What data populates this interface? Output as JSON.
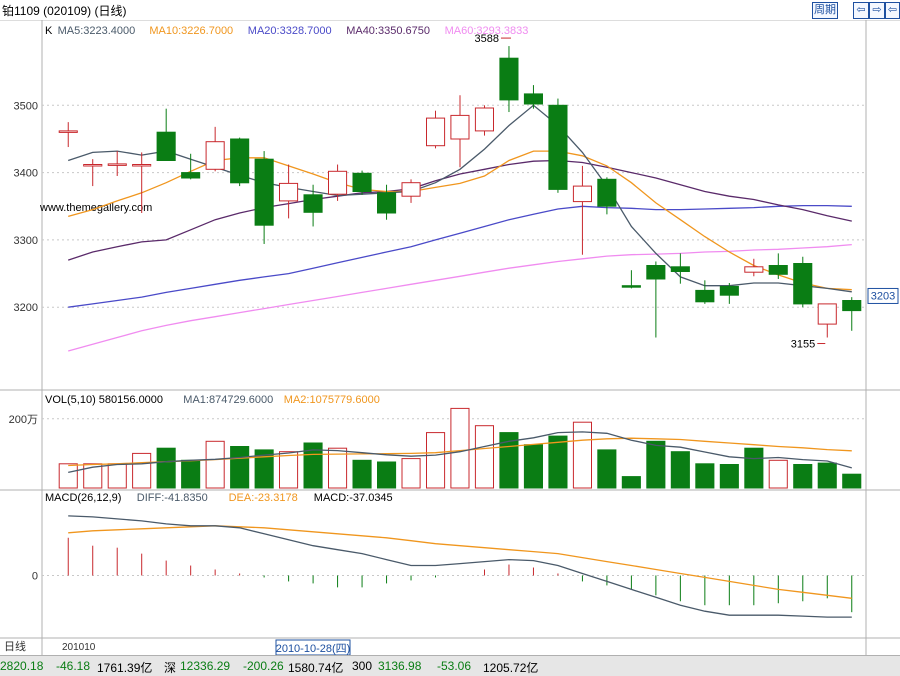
{
  "header": {
    "title": "铂1109 (020109) (日线)",
    "week_label": "周期",
    "nav_left_label": "⇦",
    "nav_right_label": "⇨",
    "nav_full_label": "⇦"
  },
  "watermark": "www.themegallery.com",
  "colors": {
    "up": "#c8282d",
    "down": "#0a7d14",
    "ma5": "#4a5a6a",
    "ma10": "#f0961e",
    "ma20": "#4a4ac8",
    "ma40": "#5a2a6a",
    "ma60": "#f08cf0",
    "vol_ma1": "#4a5a6a",
    "vol_ma2": "#f0961e",
    "diff": "#4a5a6a",
    "dea": "#f0961e"
  },
  "bottom_ticker": {
    "items": [
      {
        "text": "2820.18",
        "color": "#0a7d14"
      },
      {
        "text": "-46.18",
        "color": "#0a7d14"
      },
      {
        "text": "1761.39亿",
        "color": "#000000"
      },
      {
        "text": "深",
        "color": "#000000"
      },
      {
        "text": "12336.29",
        "color": "#0a7d14"
      },
      {
        "text": "-200.26",
        "color": "#0a7d14"
      },
      {
        "text": "1580.74亿",
        "color": "#000000"
      },
      {
        "text": "300",
        "color": "#000000"
      },
      {
        "text": "3136.98",
        "color": "#0a7d14"
      },
      {
        "text": "-53.06",
        "color": "#0a7d14"
      },
      {
        "text": "1205.72亿",
        "color": "#000000"
      }
    ]
  },
  "chart_data": [
    {
      "type": "candlestick",
      "title": "K",
      "legend": [
        {
          "label": "K",
          "color": "#000000"
        },
        {
          "label": "MA5:3223.4000",
          "color": "#4a5a6a"
        },
        {
          "label": "MA10:3226.7000",
          "color": "#f0961e"
        },
        {
          "label": "MA20:3328.7000",
          "color": "#4a4ac8"
        },
        {
          "label": "MA40:3350.6750",
          "color": "#5a2a6a"
        },
        {
          "label": "MA60:3293.3833",
          "color": "#f08cf0"
        }
      ],
      "ylim": [
        3080,
        3600
      ],
      "yticks": [
        3200,
        3300,
        3400,
        3500
      ],
      "last_price_label": "3203",
      "annotations": [
        {
          "label": "3588",
          "index": 18
        },
        {
          "label": "3155",
          "index": 31
        }
      ],
      "candles": [
        {
          "o": 3460,
          "c": 3462,
          "h": 3475,
          "l": 3438
        },
        {
          "o": 3410,
          "c": 3412,
          "h": 3420,
          "l": 3380
        },
        {
          "o": 3412,
          "c": 3413,
          "h": 3432,
          "l": 3395
        },
        {
          "o": 3410,
          "c": 3412,
          "h": 3430,
          "l": 3340
        },
        {
          "o": 3460,
          "c": 3418,
          "h": 3495,
          "l": 3418
        },
        {
          "o": 3400,
          "c": 3392,
          "h": 3428,
          "l": 3390
        },
        {
          "o": 3405,
          "c": 3446,
          "h": 3468,
          "l": 3402
        },
        {
          "o": 3450,
          "c": 3385,
          "h": 3452,
          "l": 3380
        },
        {
          "o": 3420,
          "c": 3322,
          "h": 3432,
          "l": 3294
        },
        {
          "o": 3358,
          "c": 3384,
          "h": 3412,
          "l": 3332
        },
        {
          "o": 3367,
          "c": 3341,
          "h": 3382,
          "l": 3320
        },
        {
          "o": 3368,
          "c": 3402,
          "h": 3412,
          "l": 3358
        },
        {
          "o": 3399,
          "c": 3372,
          "h": 3403,
          "l": 3367
        },
        {
          "o": 3370,
          "c": 3340,
          "h": 3382,
          "l": 3330
        },
        {
          "o": 3365,
          "c": 3385,
          "h": 3390,
          "l": 3355
        },
        {
          "o": 3440,
          "c": 3481,
          "h": 3492,
          "l": 3436
        },
        {
          "o": 3450,
          "c": 3485,
          "h": 3515,
          "l": 3408
        },
        {
          "o": 3462,
          "c": 3496,
          "h": 3500,
          "l": 3455
        },
        {
          "o": 3570,
          "c": 3508,
          "h": 3588,
          "l": 3490
        },
        {
          "o": 3517,
          "c": 3502,
          "h": 3530,
          "l": 3495
        },
        {
          "o": 3500,
          "c": 3375,
          "h": 3510,
          "l": 3370
        },
        {
          "o": 3357,
          "c": 3380,
          "h": 3410,
          "l": 3278
        },
        {
          "o": 3390,
          "c": 3350,
          "h": 3393,
          "l": 3338
        },
        {
          "o": 3232,
          "c": 3230,
          "h": 3255,
          "l": 3228
        },
        {
          "o": 3262,
          "c": 3242,
          "h": 3268,
          "l": 3155
        },
        {
          "o": 3260,
          "c": 3253,
          "h": 3280,
          "l": 3235
        },
        {
          "o": 3225,
          "c": 3208,
          "h": 3240,
          "l": 3205
        },
        {
          "o": 3231,
          "c": 3218,
          "h": 3236,
          "l": 3205
        },
        {
          "o": 3252,
          "c": 3260,
          "h": 3272,
          "l": 3246
        },
        {
          "o": 3262,
          "c": 3249,
          "h": 3280,
          "l": 3242
        },
        {
          "o": 3265,
          "c": 3205,
          "h": 3275,
          "l": 3200
        },
        {
          "o": 3175,
          "c": 3205,
          "h": 3205,
          "l": 3155
        },
        {
          "o": 3210,
          "c": 3195,
          "h": 3215,
          "l": 3165
        }
      ],
      "ma5": [
        3418,
        3430,
        3432,
        3426,
        3432,
        3420,
        3408,
        3396,
        3385,
        3378,
        3372,
        3366,
        3368,
        3370,
        3372,
        3385,
        3405,
        3435,
        3470,
        3500,
        3470,
        3430,
        3380,
        3320,
        3280,
        3245,
        3232,
        3232,
        3236,
        3236,
        3232,
        3228,
        3223
      ],
      "ma10": [
        3335,
        3345,
        3358,
        3370,
        3385,
        3402,
        3418,
        3422,
        3422,
        3410,
        3398,
        3385,
        3375,
        3372,
        3372,
        3378,
        3384,
        3395,
        3418,
        3432,
        3432,
        3425,
        3410,
        3385,
        3355,
        3330,
        3305,
        3282,
        3262,
        3248,
        3236,
        3228,
        3226
      ],
      "ma20": [
        3200,
        3205,
        3210,
        3215,
        3222,
        3228,
        3234,
        3240,
        3245,
        3250,
        3258,
        3266,
        3274,
        3282,
        3290,
        3300,
        3310,
        3320,
        3330,
        3338,
        3346,
        3350,
        3348,
        3347,
        3345,
        3345,
        3346,
        3347,
        3348,
        3350,
        3351,
        3351,
        3350
      ],
      "ma40": [
        3270,
        3282,
        3290,
        3297,
        3300,
        3315,
        3330,
        3340,
        3348,
        3354,
        3360,
        3365,
        3370,
        3372,
        3376,
        3388,
        3398,
        3405,
        3412,
        3417,
        3418,
        3415,
        3408,
        3400,
        3392,
        3382,
        3372,
        3365,
        3360,
        3352,
        3345,
        3336,
        3328
      ],
      "ma60": [
        3135,
        3145,
        3155,
        3165,
        3173,
        3180,
        3186,
        3192,
        3198,
        3204,
        3210,
        3216,
        3222,
        3228,
        3234,
        3240,
        3246,
        3252,
        3258,
        3263,
        3268,
        3272,
        3276,
        3278,
        3279,
        3280,
        3282,
        3283,
        3285,
        3286,
        3288,
        3290,
        3293
      ]
    },
    {
      "type": "bar",
      "title": "VOL(5,10)",
      "legend": [
        {
          "label": "VOL(5,10) 580156.0000",
          "color": "#000000"
        },
        {
          "label": "MA1:874729.6000",
          "color": "#4a5a6a"
        },
        {
          "label": "MA2:1075779.6000",
          "color": "#f0961e"
        }
      ],
      "ylim": [
        0,
        2600000
      ],
      "yticks": [
        2000000
      ],
      "ytick_labels": [
        "200万"
      ],
      "values": [
        700000,
        700000,
        700000,
        1000000,
        1150000,
        800000,
        1350000,
        1200000,
        1100000,
        1050000,
        1300000,
        1150000,
        800000,
        750000,
        850000,
        1600000,
        2300000,
        1800000,
        1600000,
        1250000,
        1500000,
        1900000,
        1100000,
        330000,
        1350000,
        1050000,
        700000,
        680000,
        1150000,
        800000,
        680000,
        720000,
        400000
      ],
      "up": [
        true,
        true,
        true,
        true,
        false,
        false,
        true,
        false,
        false,
        true,
        false,
        true,
        false,
        false,
        true,
        true,
        true,
        true,
        false,
        false,
        false,
        true,
        false,
        false,
        false,
        false,
        false,
        false,
        false,
        true,
        false,
        false,
        false
      ],
      "ma1": [
        450000,
        600000,
        680000,
        700000,
        760000,
        800000,
        830000,
        880000,
        950000,
        1010000,
        1100000,
        1080000,
        1020000,
        960000,
        920000,
        950000,
        1050000,
        1200000,
        1350000,
        1450000,
        1600000,
        1620000,
        1580000,
        1380000,
        1230000,
        1180000,
        1040000,
        900000,
        850000,
        880000,
        820000,
        780000,
        580000
      ],
      "ma2": [
        650000,
        680000,
        700000,
        730000,
        760000,
        790000,
        820000,
        860000,
        900000,
        940000,
        970000,
        980000,
        985000,
        990000,
        1000000,
        1020000,
        1080000,
        1140000,
        1200000,
        1260000,
        1320000,
        1380000,
        1420000,
        1440000,
        1420000,
        1400000,
        1350000,
        1300000,
        1250000,
        1200000,
        1160000,
        1110000,
        1075000
      ]
    },
    {
      "type": "bar",
      "title": "MACD(26,12,9)",
      "legend": [
        {
          "label": "MACD(26,12,9)",
          "color": "#000000"
        },
        {
          "label": "DIFF:-41.8350",
          "color": "#4a5a6a"
        },
        {
          "label": "DEA:-23.3178",
          "color": "#f0961e"
        },
        {
          "label": "MACD:-37.0345",
          "color": "#000000"
        }
      ],
      "ylim": [
        -60,
        70
      ],
      "yticks": [
        0
      ],
      "ytick_labels": [
        "0"
      ],
      "values": [
        38,
        30,
        28,
        22,
        15,
        10,
        6,
        2,
        -2,
        -6,
        -8,
        -12,
        -12,
        -8,
        -5,
        -2,
        0,
        6,
        11,
        8,
        2,
        -6,
        -10,
        -14,
        -20,
        -26,
        -30,
        -30,
        -30,
        -28,
        -26,
        -23,
        -37
      ],
      "diff": [
        60,
        59,
        57,
        55,
        52,
        50,
        50,
        48,
        42,
        36,
        30,
        26,
        22,
        16,
        10,
        10,
        12,
        14,
        16,
        15,
        10,
        2,
        -6,
        -14,
        -22,
        -30,
        -36,
        -40,
        -40,
        -40,
        -41,
        -42,
        -42
      ],
      "dea": [
        43,
        45,
        46,
        47,
        48,
        49,
        50,
        49,
        48,
        46,
        44,
        42,
        40,
        38,
        35,
        32,
        30,
        28,
        26,
        24,
        22,
        18,
        14,
        10,
        6,
        2,
        -2,
        -6,
        -10,
        -14,
        -17,
        -20,
        -23
      ]
    }
  ],
  "xaxis": {
    "left_label": "日线",
    "start_label": "201010",
    "cursor_date": "2010-10-28(四)"
  }
}
